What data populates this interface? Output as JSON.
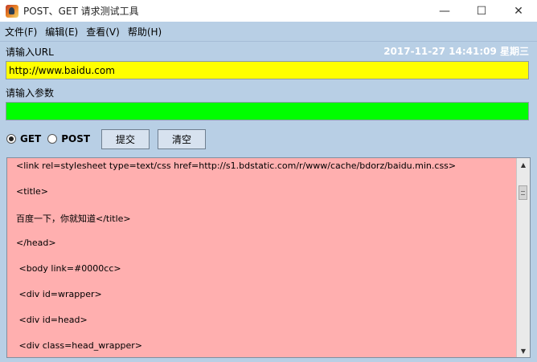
{
  "window": {
    "title": "POST、GET 请求测试工具",
    "controls": {
      "minimize": "—",
      "maximize": "☐",
      "close": "✕"
    }
  },
  "menu": {
    "items": [
      {
        "label": "文件(F)"
      },
      {
        "label": "编辑(E)"
      },
      {
        "label": "查看(V)"
      },
      {
        "label": "帮助(H)"
      }
    ]
  },
  "form": {
    "url_label": "请输入URL",
    "datetime": "2017-11-27 14:41:09 星期三",
    "url_value": "http://www.baidu.com",
    "params_label": "请输入参数",
    "params_value": ""
  },
  "options": {
    "get_label": "GET",
    "post_label": "POST",
    "selected": "GET",
    "submit_label": "提交",
    "clear_label": "清空"
  },
  "output": {
    "lines": [
      "<link rel=stylesheet type=text/css href=http://s1.bdstatic.com/r/www/cache/bdorz/baidu.min.css>",
      "<title>",
      "百度一下，你就知道</title>",
      "</head>",
      " <body link=#0000cc>",
      " <div id=wrapper>",
      " <div id=head>",
      " <div class=head_wrapper>"
    ]
  },
  "colors": {
    "url_field_bg": "#ffff00",
    "params_field_bg": "#00ff00",
    "output_bg": "#ffafaf",
    "window_bg": "#b8cfe5"
  }
}
